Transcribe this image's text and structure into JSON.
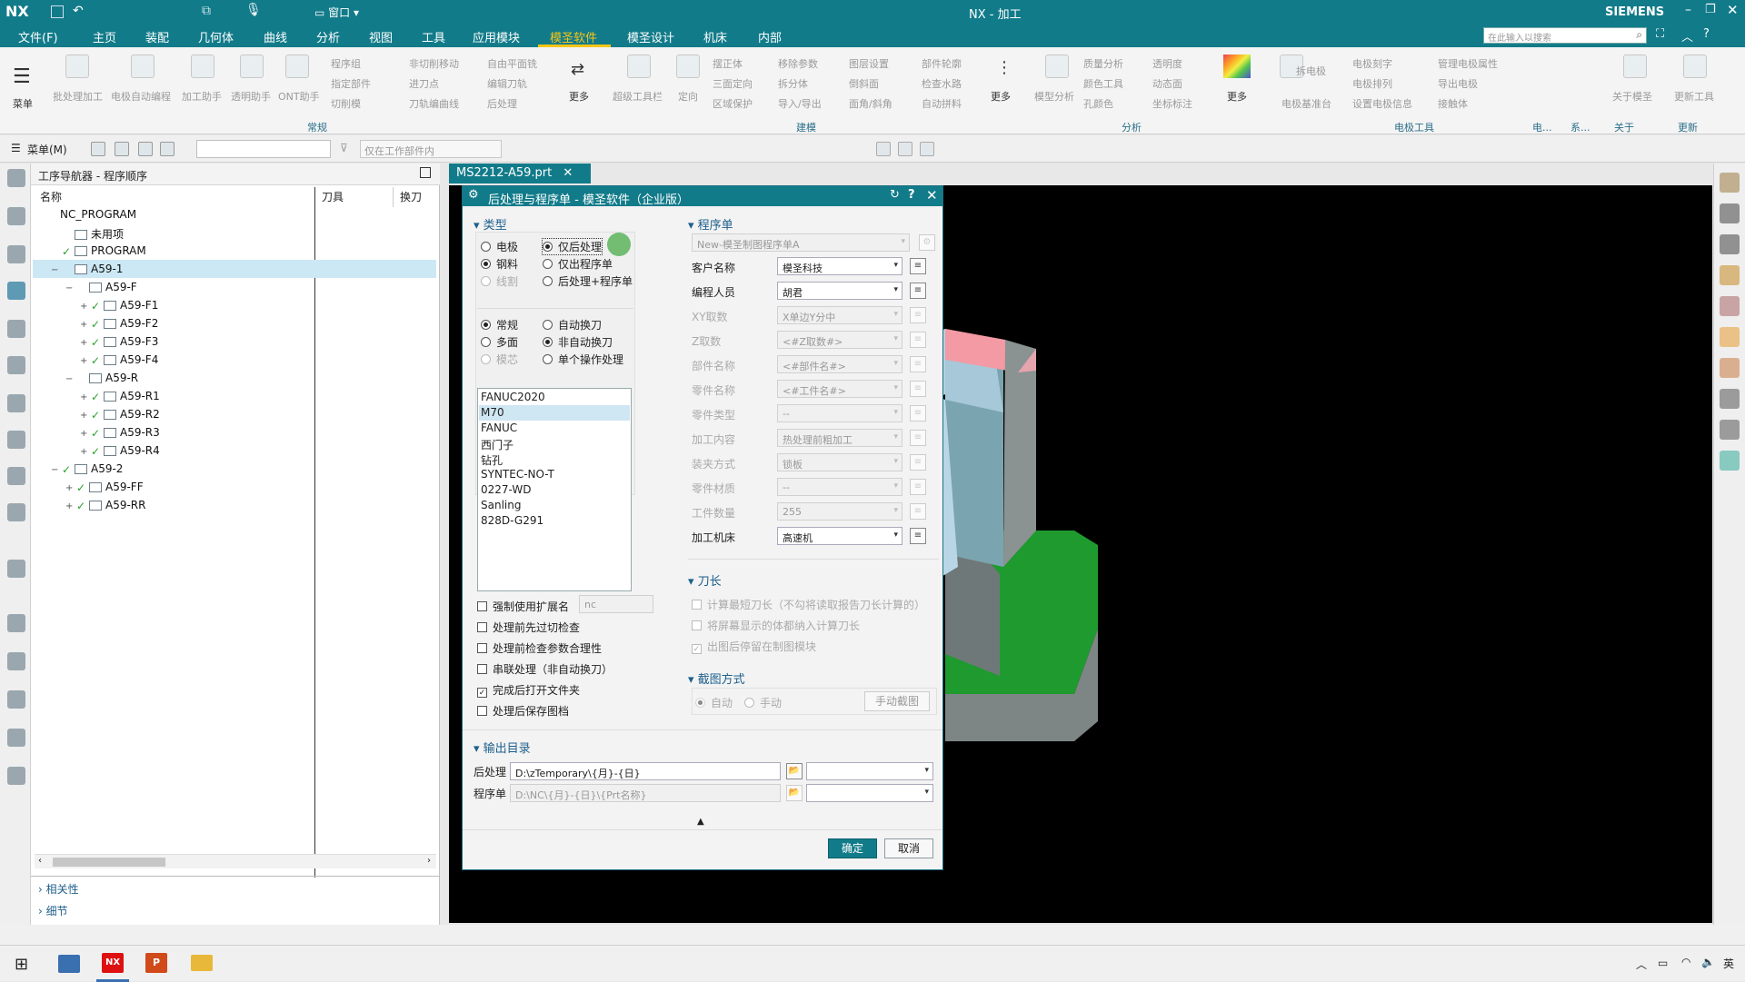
{
  "app": {
    "logo": "NX",
    "window_title": "NX - 加工",
    "brand": "SIEMENS",
    "search_placeholder": "在此输入以搜索"
  },
  "menubar": [
    "文件(F)",
    "主页",
    "装配",
    "几何体",
    "曲线",
    "分析",
    "视图",
    "工具",
    "应用模块",
    "模圣软件",
    "模圣设计",
    "机床",
    "内部"
  ],
  "menubar_active": "模圣软件",
  "ribbon": {
    "menu_label": "菜单",
    "big_buttons": [
      "批处理加工",
      "电极自动编程",
      "加工助手",
      "透明助手",
      "ONT助手"
    ],
    "small_col1": [
      "程序组",
      "指定部件",
      "切削模"
    ],
    "small_col2": [
      "非切削移动",
      "进刀点",
      "刀轨编曲线"
    ],
    "small_col3": [
      "自由平面铣",
      "编辑刀轨",
      "后处理"
    ],
    "more1": "更多",
    "group_changgui": "常规",
    "mid_big": [
      "超级工具栏",
      "定向"
    ],
    "small_col4": [
      "摆正体",
      "三面定向",
      "区域保护"
    ],
    "small_col5": [
      "移除参数",
      "拆分体",
      "导入/导出"
    ],
    "small_col6": [
      "图层设置",
      "倒斜面",
      "面角/斜角"
    ],
    "small_col7": [
      "部件轮廓",
      "检查水路",
      "自动拼料"
    ],
    "more2": "更多",
    "group_jianmo": "建模",
    "mid_big2": "模型分析",
    "small_col8": [
      "质量分析",
      "颜色工具",
      "孔颜色"
    ],
    "small_col9": [
      "透明度",
      "动态面",
      "坐标标注"
    ],
    "more3": "更多",
    "group_fenxi": "分析",
    "electrode_big": "拆电极",
    "small_col10": [
      "电极刻字",
      "电极排列",
      "设置电极信息"
    ],
    "small_col11": [
      "管理电极属性",
      "导出电极",
      "接触体"
    ],
    "elec_base": "电极基准台",
    "group_dianji": "电极工具",
    "tail_big": [
      "关于模圣",
      "更新工具"
    ],
    "group_tail": [
      "电...",
      "系...",
      "关于",
      "更新"
    ]
  },
  "toolbar2": {
    "menu_label": "菜单(M)",
    "filter_placeholder": "",
    "scope": "仅在工作部件内"
  },
  "navigator": {
    "title": "工序导航器 - 程序顺序",
    "columns": [
      "名称",
      "刀具",
      "换刀"
    ],
    "rows": [
      {
        "label": "NC_PROGRAM",
        "indent": 0,
        "check": false,
        "folder": false,
        "twist": ""
      },
      {
        "label": "未用项",
        "indent": 1,
        "check": false,
        "folder": true,
        "twist": ""
      },
      {
        "label": "PROGRAM",
        "indent": 1,
        "check": true,
        "folder": true,
        "twist": ""
      },
      {
        "label": "A59-1",
        "indent": 1,
        "check": false,
        "folder": true,
        "twist": "−",
        "selected": true
      },
      {
        "label": "A59-F",
        "indent": 2,
        "check": false,
        "folder": true,
        "twist": "−"
      },
      {
        "label": "A59-F1",
        "indent": 3,
        "check": true,
        "folder": true,
        "twist": "+"
      },
      {
        "label": "A59-F2",
        "indent": 3,
        "check": true,
        "folder": true,
        "twist": "+"
      },
      {
        "label": "A59-F3",
        "indent": 3,
        "check": true,
        "folder": true,
        "twist": "+"
      },
      {
        "label": "A59-F4",
        "indent": 3,
        "check": true,
        "folder": true,
        "twist": "+"
      },
      {
        "label": "A59-R",
        "indent": 2,
        "check": false,
        "folder": true,
        "twist": "−"
      },
      {
        "label": "A59-R1",
        "indent": 3,
        "check": true,
        "folder": true,
        "twist": "+"
      },
      {
        "label": "A59-R2",
        "indent": 3,
        "check": true,
        "folder": true,
        "twist": "+"
      },
      {
        "label": "A59-R3",
        "indent": 3,
        "check": true,
        "folder": true,
        "twist": "+"
      },
      {
        "label": "A59-R4",
        "indent": 3,
        "check": true,
        "folder": true,
        "twist": "+"
      },
      {
        "label": "A59-2",
        "indent": 1,
        "check": true,
        "folder": true,
        "twist": "−"
      },
      {
        "label": "A59-FF",
        "indent": 2,
        "check": true,
        "folder": true,
        "twist": "+"
      },
      {
        "label": "A59-RR",
        "indent": 2,
        "check": true,
        "folder": true,
        "twist": "+"
      }
    ],
    "footer": [
      "相关性",
      "细节"
    ]
  },
  "viewport": {
    "tab_label": "MS2212-A59.prt"
  },
  "dialog": {
    "title": "后处理与程序单 - 模圣软件（企业版）",
    "sec_type": "类型",
    "type_left": [
      {
        "label": "电极",
        "on": false,
        "dis": false
      },
      {
        "label": "钢料",
        "on": true,
        "dis": false
      },
      {
        "label": "线割",
        "on": false,
        "dis": true
      }
    ],
    "type_right": [
      {
        "label": "仅后处理",
        "on": true
      },
      {
        "label": "仅出程序单",
        "on": false
      },
      {
        "label": "后处理+程序单",
        "on": false
      }
    ],
    "mode_left": [
      {
        "label": "常规",
        "on": true,
        "dis": false
      },
      {
        "label": "多面",
        "on": false,
        "dis": false
      },
      {
        "label": "模芯",
        "on": false,
        "dis": true
      }
    ],
    "mode_right": [
      {
        "label": "自动换刀",
        "on": false
      },
      {
        "label": "非自动换刀",
        "on": true
      },
      {
        "label": "单个操作处理",
        "on": false
      }
    ],
    "postlist": [
      "FANUC2020",
      "M70",
      "FANUC",
      "西门子",
      "钻孔",
      "SYNTEC-NO-T",
      "0227-WD",
      "Sanling",
      "828D-G291"
    ],
    "postlist_selected": "M70",
    "options": [
      {
        "label": "强制使用扩展名",
        "checked": false
      },
      {
        "label": "处理前先过切检查",
        "checked": false
      },
      {
        "label": "处理前检查参数合理性",
        "checked": false
      },
      {
        "label": "串联处理（非自动换刀）",
        "checked": false
      },
      {
        "label": "完成后打开文件夹",
        "checked": true
      },
      {
        "label": "处理后保存图档",
        "checked": false
      }
    ],
    "ext_value": "nc",
    "sec_prog": "程序单",
    "prog_template": "New-模圣制图程序单A",
    "fields": [
      {
        "label": "客户名称",
        "value": "模圣科技",
        "dis": false
      },
      {
        "label": "编程人员",
        "value": "胡君",
        "dis": false
      },
      {
        "label": "XY取数",
        "value": "X单边Y分中",
        "dis": true
      },
      {
        "label": "Z取数",
        "value": "<#Z取数#>",
        "dis": true
      },
      {
        "label": "部件名称",
        "value": "<#部件名#>",
        "dis": true
      },
      {
        "label": "零件名称",
        "value": "<#工件名#>",
        "dis": true
      },
      {
        "label": "零件类型",
        "value": "--",
        "dis": true
      },
      {
        "label": "加工内容",
        "value": "热处理前粗加工",
        "dis": true
      },
      {
        "label": "装夹方式",
        "value": "锁板",
        "dis": true
      },
      {
        "label": "零件材质",
        "value": "--",
        "dis": true
      },
      {
        "label": "工件数量",
        "value": "255",
        "dis": true
      },
      {
        "label": "加工机床",
        "value": "高速机",
        "dis": false
      }
    ],
    "sec_tool": "刀长",
    "tool_opts": [
      {
        "label": "计算最短刀长（不勾将读取报告刀长计算的）",
        "checked": false
      },
      {
        "label": "将屏幕显示的体都纳入计算刀长",
        "checked": false
      },
      {
        "label": "出图后停留在制图模块",
        "checked": true
      }
    ],
    "sec_shot": "截图方式",
    "shot_auto": "自动",
    "shot_manual": "手动",
    "shot_btn": "手动截图",
    "sec_out": "输出目录",
    "out_post_label": "后处理",
    "out_post_value": "D:\\zTemporary\\{月}-{日}",
    "out_prog_label": "程序单",
    "out_prog_value": "D:\\NC\\{月}-{日}\\{Prt名称}",
    "ok": "确定",
    "cancel": "取消"
  },
  "taskbar": {
    "tray_lang": "英"
  }
}
